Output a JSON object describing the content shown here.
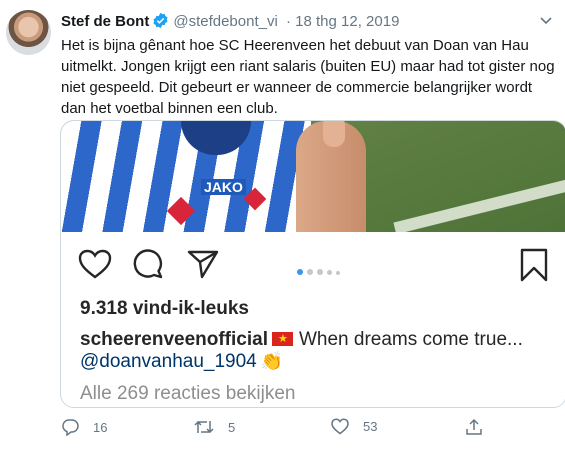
{
  "tweet": {
    "author_name": "Stef de Bont",
    "handle": "@stefdebont_vi",
    "date": "· 18 thg 12, 2019",
    "text": "Het is bijna gênant hoe SC Heerenveen het debuut van Doan van Hau uitmelkt. Jongen krijgt een riant salaris (buiten EU) maar had tot gister nog niet gespeeld. Dit gebeurt er wanneer de commercie belangrijker wordt dan het voetbal binnen een club."
  },
  "embed": {
    "shirt_text": "JAKO",
    "likes": "9.318 vind-ik-leuks",
    "caption_user": "scheerenveenofficial",
    "caption_text": "When dreams come true...",
    "mention": "@doanvanhau_1904",
    "comments_link": "Alle 269 reacties bekijken",
    "carousel_index": 1,
    "carousel_count": 5
  },
  "footer": {
    "reply_count": "16",
    "retweet_count": "5",
    "like_count": "53"
  },
  "colors": {
    "verified": "#1da1f2",
    "carousel_active": "#3897f0",
    "vietnam_flag": "#da251d"
  }
}
